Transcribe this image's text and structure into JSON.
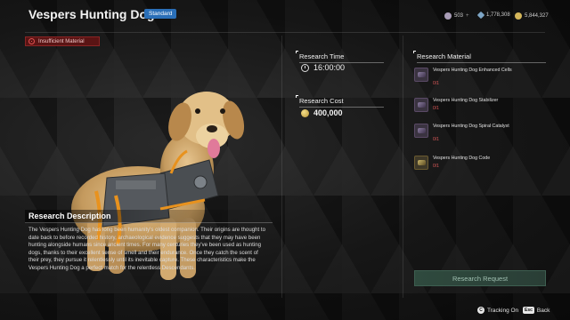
{
  "header": {
    "title": "Vespers Hunting Dog",
    "grade": "Standard",
    "currencies": [
      {
        "icon": "caliber-icon",
        "value": "503",
        "suffix": "+",
        "color": "#c0b8c8"
      },
      {
        "icon": "crystal-icon",
        "value": "1,778,308",
        "color": "#9ab8d0"
      },
      {
        "icon": "gold-icon",
        "value": "5,844,327",
        "color": "#d8c070"
      }
    ]
  },
  "alert": {
    "text": "Insufficient Material",
    "icon": "warning-icon",
    "color": "#8a2424"
  },
  "description": {
    "title": "Research Description",
    "text": "The Vespers Hunting Dog has long been humanity's oldest companion. Their origins are thought to date back to before recorded history, archaeological evidence suggests that they may have been hunting alongside humans since ancient times. For many centuries they've been used as hunting dogs, thanks to their excellent sense of smell and their endurance. Once they catch the scent of their prey, they pursue it relentlessly until its inevitable capture. These characteristics make the Vespers Hunting Dog a perfect match for the relentless Descendants."
  },
  "research": {
    "time_label": "Research Time",
    "time_value": "16:00:00",
    "cost_label": "Research Cost",
    "cost_value": "400,000"
  },
  "materials": {
    "title": "Research Material",
    "items": [
      {
        "name": "Vespers Hunting Dog Enhanced Cells",
        "count": "0/1",
        "icon": "cells-icon"
      },
      {
        "name": "Vespers Hunting Dog Stabilizer",
        "count": "0/1",
        "icon": "stabilizer-icon"
      },
      {
        "name": "Vespers Hunting Dog Spiral Catalyst",
        "count": "0/1",
        "icon": "catalyst-icon"
      },
      {
        "name": "Vespers Hunting Dog Code",
        "count": "0/1",
        "icon": "code-icon"
      }
    ]
  },
  "actions": {
    "request_label": "Research Request",
    "tracking_key": "C",
    "tracking_label": "Tracking On",
    "back_key": "Esc",
    "back_label": "Back"
  }
}
